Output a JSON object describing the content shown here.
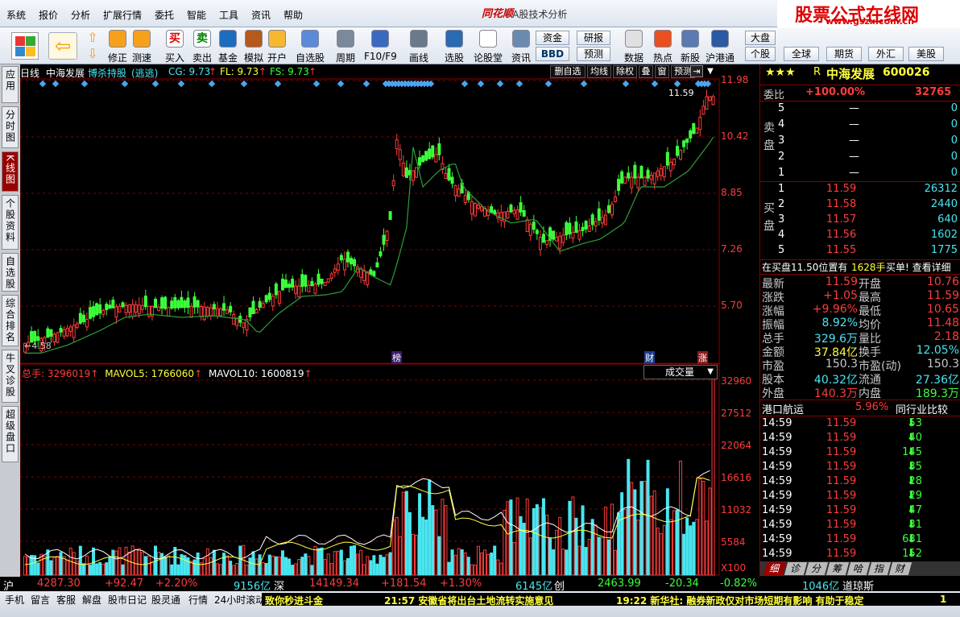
{
  "menu": [
    "系统",
    "报价",
    "分析",
    "扩展行情",
    "委托",
    "智能",
    "工具",
    "资讯",
    "帮助"
  ],
  "app_logo": "同花顺",
  "app_title": "- A股技术分析",
  "brand": {
    "title": "股票公式在线网",
    "url": "www.gszx.com.cn"
  },
  "toolbar": [
    {
      "label": "修正",
      "icon": "fix-icon"
    },
    {
      "label": "测速",
      "icon": "speed-icon"
    },
    {
      "label": "买入",
      "icon": "buy-icon"
    },
    {
      "label": "卖出",
      "icon": "sell-icon"
    },
    {
      "label": "基金",
      "icon": "fund-icon"
    },
    {
      "label": "模拟",
      "icon": "simulate-icon"
    },
    {
      "label": "开户",
      "icon": "account-icon"
    },
    {
      "label": "自选股",
      "icon": "watchlist-icon"
    },
    {
      "label": "周期",
      "icon": "period-icon"
    },
    {
      "label": "F10/F9",
      "icon": "f10-icon"
    },
    {
      "label": "画线",
      "icon": "draw-line-icon"
    },
    {
      "label": "选股",
      "icon": "stock-pick-icon"
    },
    {
      "label": "论股堂",
      "icon": "forum-icon"
    },
    {
      "label": "资讯",
      "icon": "news-icon"
    },
    {
      "label": "数据",
      "icon": "data-icon"
    },
    {
      "label": "热点",
      "icon": "hot-icon"
    },
    {
      "label": "新股",
      "icon": "new-stock-icon"
    },
    {
      "label": "沪港通",
      "icon": "hk-connect-icon"
    }
  ],
  "toolbar_buttons": {
    "capital": "资金",
    "bbd": "BBD",
    "research": "研报",
    "forecast": "预测",
    "market": "大盘",
    "stock": "个股",
    "global": "全球",
    "futures": "期货",
    "forex": "外汇",
    "us": "美股"
  },
  "buy_glyph": "买",
  "sell_glyph": "卖",
  "left_tabs": [
    "应用",
    "分时图",
    "K线图",
    "个股资料",
    "自选股",
    "综合排名",
    "牛叉诊股",
    "超级盘口"
  ],
  "chart": {
    "period": "日线",
    "stock_name": "中海发展",
    "indicator": "博杀持股",
    "indicator_sub": "(逃逃)",
    "cg": "CG: 9.73",
    "fl": "FL: 9.73",
    "fs": "FS: 9.73",
    "tools": [
      "删自选",
      "均线",
      "除权",
      "叠",
      "窗",
      "预测"
    ],
    "price_ticks": [
      "11.98",
      "10.42",
      "8.85",
      "7.26",
      "5.70"
    ],
    "high_label": "11.59",
    "low_label": "4.58",
    "markers": [
      "榜",
      "财",
      "涨"
    ],
    "vol_info": {
      "total": "总手: 3296019",
      "mavol5": "MAVOL5: 1766060",
      "mavol10": "MAVOL10: 1600819"
    },
    "vol_selector": "成交量",
    "vol_ticks": [
      "32960",
      "27512",
      "22064",
      "16616",
      "11032",
      "5584",
      "X100"
    ]
  },
  "quote": {
    "stars": "★★★",
    "flag": "R",
    "name": "中海发展",
    "code": "600026",
    "weibi_label": "委比",
    "weibi_value": "+100.00%",
    "weicha": "32765",
    "sell_label": "卖盘",
    "buy_label": "买盘",
    "asks": [
      {
        "lvl": "5",
        "price": "—",
        "vol": "0"
      },
      {
        "lvl": "4",
        "price": "—",
        "vol": "0"
      },
      {
        "lvl": "3",
        "price": "—",
        "vol": "0"
      },
      {
        "lvl": "2",
        "price": "—",
        "vol": "0"
      },
      {
        "lvl": "1",
        "price": "—",
        "vol": "0"
      }
    ],
    "bids": [
      {
        "lvl": "1",
        "price": "11.59",
        "vol": "26312"
      },
      {
        "lvl": "2",
        "price": "11.58",
        "vol": "2440"
      },
      {
        "lvl": "3",
        "price": "11.57",
        "vol": "640"
      },
      {
        "lvl": "4",
        "price": "11.56",
        "vol": "1602"
      },
      {
        "lvl": "5",
        "price": "11.55",
        "vol": "1775"
      }
    ],
    "notice": "在买盘11.50位置有",
    "notice_vol": "1628手",
    "notice_tail": "买单! 查看详细",
    "stats": [
      {
        "l1": "最新",
        "v1": "11.59",
        "l2": "开盘",
        "v2": "10.76"
      },
      {
        "l1": "涨跌",
        "v1": "+1.05",
        "l2": "最高",
        "v2": "11.59"
      },
      {
        "l1": "涨幅",
        "v1": "+9.96%",
        "l2": "最低",
        "v2": "10.65"
      },
      {
        "l1": "振幅",
        "v1": "8.92%",
        "l2": "均价",
        "v2": "11.48"
      },
      {
        "l1": "总手",
        "v1": "329.6万",
        "l2": "量比",
        "v2": "2.18"
      },
      {
        "l1": "金额",
        "v1": "37.84亿",
        "l2": "换手",
        "v2": "12.05%"
      },
      {
        "l1": "市盈",
        "v1": "150.3",
        "l2": "市盈(动)",
        "v2": "150.3"
      },
      {
        "l1": "股本",
        "v1": "40.32亿",
        "l2": "流通",
        "v2": "27.36亿"
      },
      {
        "l1": "外盘",
        "v1": "140.3万",
        "l2": "内盘",
        "v2": "189.3万"
      }
    ],
    "sector": {
      "name": "港口航运",
      "pct": "5.96%",
      "compare": "同行业比较"
    },
    "ticks": [
      {
        "t": "14:59",
        "p": "11.59",
        "v": "53"
      },
      {
        "t": "14:59",
        "p": "11.59",
        "v": "40"
      },
      {
        "t": "14:59",
        "p": "11.59",
        "v": "145"
      },
      {
        "t": "14:59",
        "p": "11.59",
        "v": "35"
      },
      {
        "t": "14:59",
        "p": "11.59",
        "v": "28"
      },
      {
        "t": "14:59",
        "p": "11.59",
        "v": "29"
      },
      {
        "t": "14:59",
        "p": "11.59",
        "v": "47"
      },
      {
        "t": "14:59",
        "p": "11.59",
        "v": "31"
      },
      {
        "t": "14:59",
        "p": "11.59",
        "v": "631"
      },
      {
        "t": "14:59",
        "p": "11.59",
        "v": "152"
      }
    ],
    "bottom_tabs": [
      "细",
      "诊",
      "分",
      "筹",
      "哈",
      "指",
      "财"
    ]
  },
  "status": {
    "sh": "沪",
    "sh_idx": "4287.30",
    "sh_chg": "+92.47",
    "sh_pct": "+2.20%",
    "sh_amt": "9156亿",
    "sz": "深",
    "sz_idx": "14149.34",
    "sz_chg": "+181.54",
    "sz_pct": "+1.30%",
    "sz_amt": "6145亿",
    "cy": "创",
    "cy_idx": "2463.99",
    "cy_chg": "-20.34",
    "cy_pct": "-0.82%",
    "dj_amt": "1046亿",
    "dj": "道琼斯"
  },
  "bottom_links": [
    "手机",
    "留言",
    "客服",
    "解盘",
    "股市日记",
    "股灵通",
    "行情",
    "24小时滚动"
  ],
  "ticker": {
    "t0": "致你秒进斗金",
    "t1": "21:57 安徽省将出台土地流转实施意见",
    "t2": "19:22 新华社: 融券新政仅对市场短期有影响 有助于稳定",
    "t3": "1"
  },
  "colors": {
    "up": "#ff3c3c",
    "down": "#3cff3c",
    "flat": "#49e6f0",
    "ma": "#2e9e3a",
    "label": "#c8c8c8"
  }
}
